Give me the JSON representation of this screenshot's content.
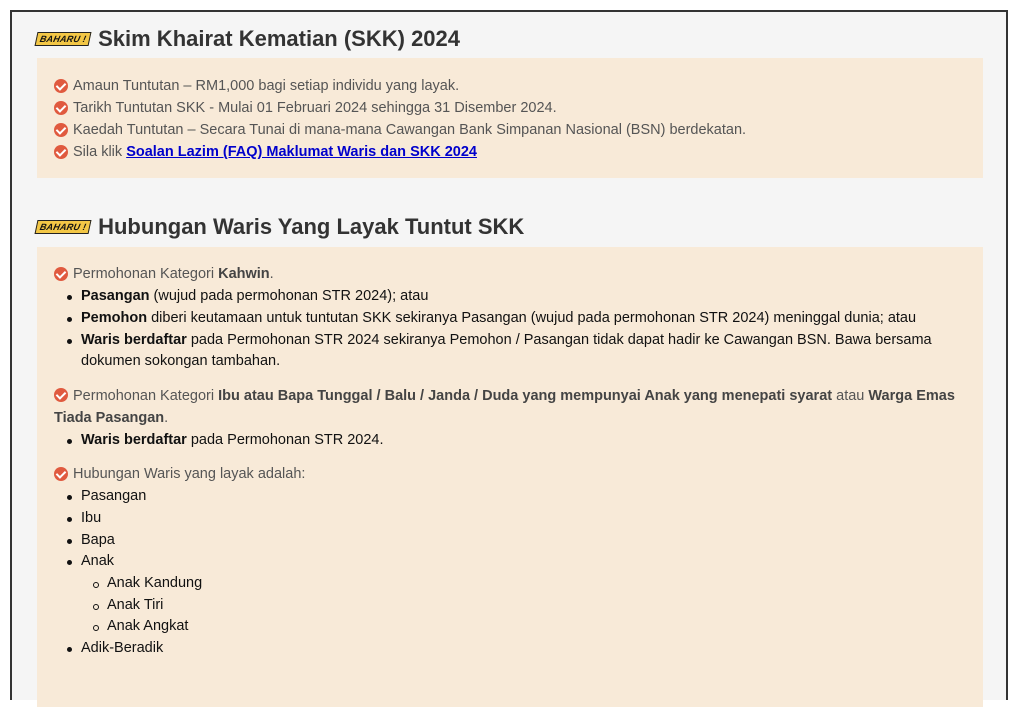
{
  "section1": {
    "badge": "BAHARU !",
    "title": "Skim Khairat Kematian (SKK) 2024",
    "items": [
      "Amaun Tuntutan – RM1,000 bagi setiap individu yang layak.",
      "Tarikh Tuntutan SKK - Mulai 01 Februari 2024 sehingga 31 Disember 2024.",
      "Kaedah Tuntutan – Secara Tunai di mana-mana Cawangan Bank Simpanan Nasional (BSN) berdekatan."
    ],
    "faq_prefix": "Sila klik",
    "faq_link": "Soalan Lazim (FAQ) Maklumat Waris dan SKK 2024"
  },
  "section2": {
    "badge": "BAHARU !",
    "title": "Hubungan Waris Yang Layak Tuntut SKK",
    "cat1": {
      "prefix": "Permohonan Kategori",
      "bold": "Kahwin",
      "suffix": ".",
      "bullets": [
        {
          "bold": "Pasangan",
          "text": " (wujud pada permohonan STR 2024); atau"
        },
        {
          "bold": "Pemohon",
          "text": " diberi keutamaan untuk tuntutan SKK sekiranya Pasangan (wujud pada permohonan STR 2024) meninggal dunia; atau"
        },
        {
          "bold": "Waris berdaftar",
          "text": " pada Permohonan STR 2024 sekiranya Pemohon / Pasangan tidak dapat hadir ke Cawangan BSN. Bawa bersama",
          "text2": "dokumen sokongan tambahan."
        }
      ]
    },
    "cat2": {
      "prefix": "Permohonan Kategori",
      "bold1": "Ibu atau Bapa Tunggal / Balu / Janda / Duda yang mempunyai Anak yang menepati syarat",
      "mid": "atau",
      "bold2": "Warga Emas",
      "bold3": "Tiada Pasangan",
      "suffix": ".",
      "bullet_bold": "Waris berdaftar",
      "bullet_text": " pada Permohonan STR 2024."
    },
    "cat3": {
      "intro": "Hubungan Waris yang layak adalah:",
      "list": [
        "Pasangan",
        "Ibu",
        "Bapa",
        "Anak"
      ],
      "anak_sub": [
        "Anak Kandung",
        "Anak Tiri",
        "Anak Angkat"
      ],
      "last": "Adik-Beradik"
    }
  }
}
